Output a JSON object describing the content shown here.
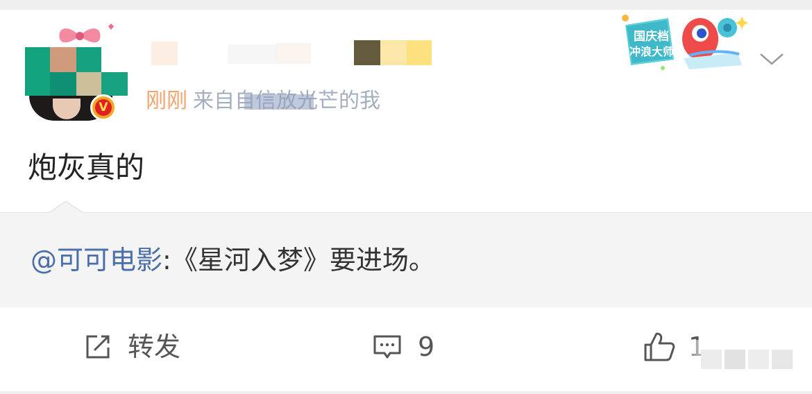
{
  "post": {
    "time": "刚刚",
    "source": "来自自信放光芒的我",
    "text": "炮灰真的",
    "verified_mark": "V"
  },
  "repost": {
    "mention": "@可可电影",
    "text": ":《星河入梦》要进场。"
  },
  "actions": {
    "share_label": "转发",
    "comment_count": "9",
    "like_count": "1"
  },
  "badge": {
    "line1": "国庆档",
    "line2": "冲浪大师"
  },
  "icons": {
    "share": "share-icon",
    "comment": "comment-icon",
    "like": "thumbs-up-icon",
    "more": "chevron-down-icon"
  },
  "colors": {
    "time": "#f5a26b",
    "source": "#93a0b3",
    "mention": "#4a6ea9",
    "repost_bg": "#f4f4f4",
    "verified": "#f5a623"
  }
}
